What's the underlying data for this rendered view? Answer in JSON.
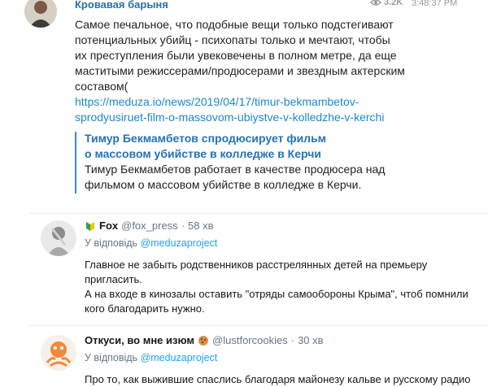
{
  "telegram_post": {
    "author": "Кровавая барыня",
    "views": "3.2K",
    "time": "3:48:37 PM",
    "text_lines": [
      "Самое печальное, что подобные вещи только подстегивают",
      "потенциальных убийц - психопаты только и мечтают, чтобы",
      "их преступления были увековечены в полном метре, да еще",
      "маститыми  режиссерами/продюсерами и звездным актерским",
      "составом("
    ],
    "link_lines": [
      "https://meduza.io/news/2019/04/17/timur-bekmambetov-",
      "sprodyusiruet-film-o-massovom-ubiystve-v-kolledzhe-v-kerchi"
    ],
    "preview": {
      "title_lines": [
        "Тимур Бекмамбетов спродюсирует фильм",
        "о массовом убийстве в колледже в Керчи"
      ],
      "desc_lines": [
        "Тимур Бекмамбетов работает в качестве продюсера над",
        "фильмом о массовом убийстве в колледже в Керчи."
      ]
    }
  },
  "replies": [
    {
      "name": "Fox",
      "handle": "@fox_press",
      "time": "58 хв",
      "reply_to_label": "У відповідь",
      "reply_to_account": "@meduzaproject",
      "text_lines": [
        "Главное не забыть родственников расстрелянных детей на премьеру",
        "пригласить.",
        "А на входе в кинозалы оставить \"отряды самообороны Крыма\", чтоб помнили",
        "кого благодарить нужно."
      ]
    },
    {
      "name": "Откуси, во мне изюм",
      "handle": "@lustforcookies",
      "time": "30 хв",
      "reply_to_label": "У відповідь",
      "reply_to_account": "@meduzaproject",
      "text_lines": [
        "Про то, как выжившие спаслись благодаря майонезу кальве и русскому радио"
      ]
    }
  ],
  "colors": {
    "telegram_name": "#2b6fa8",
    "link": "#1f86c7",
    "preview_bar": "#3a8ad6",
    "twitter_blue": "#1da1f2"
  },
  "icons": {
    "views": "eye-icon",
    "fox_badge": "green-badge-icon",
    "cookie": "cookie-emoji-icon"
  },
  "separator": "·"
}
